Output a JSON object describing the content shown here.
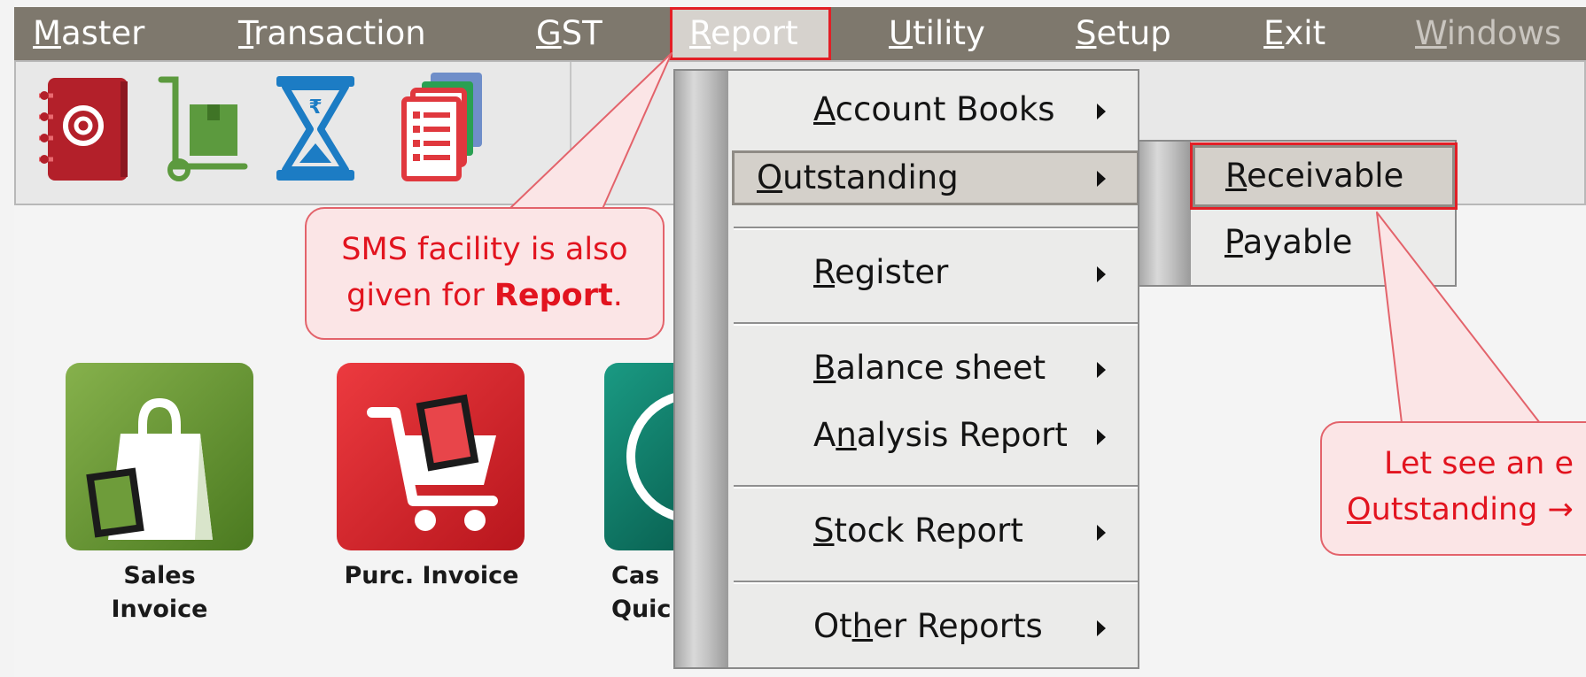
{
  "menubar": {
    "items": [
      {
        "pre": "",
        "ul": "M",
        "post": "aster"
      },
      {
        "pre": "",
        "ul": "T",
        "post": "ransaction"
      },
      {
        "pre": "",
        "ul": "G",
        "post": "ST"
      },
      {
        "pre": "",
        "ul": "R",
        "post": "eport"
      },
      {
        "pre": "",
        "ul": "U",
        "post": "tility"
      },
      {
        "pre": "",
        "ul": "S",
        "post": "etup"
      },
      {
        "pre": "",
        "ul": "E",
        "post": "xit"
      },
      {
        "pre": "",
        "ul": "W",
        "post": "indows"
      }
    ]
  },
  "toolbar": {
    "icons": [
      "address-book-icon",
      "hand-truck-icon",
      "hourglass-rupee-icon",
      "report-pages-icon"
    ]
  },
  "tiles": [
    {
      "label_line1": "Sales",
      "label_line2": "Invoice",
      "icon": "shopping-bag-icon",
      "color": "#5f8a2e"
    },
    {
      "label_line1": "Purc. Invoice",
      "label_line2": "",
      "icon": "shopping-cart-icon",
      "color": "#d81f26"
    },
    {
      "label_line1": "Cas",
      "label_line2": "Quic",
      "icon": "cash-icon",
      "color": "#0f7d6a"
    }
  ],
  "dropdown": {
    "items": [
      {
        "pre": "",
        "ul": "A",
        "post": "ccount Books"
      },
      {
        "pre": "",
        "ul": "O",
        "post": "utstanding"
      },
      {
        "pre": "",
        "ul": "R",
        "post": "egister"
      },
      {
        "pre": "",
        "ul": "B",
        "post": "alance sheet"
      },
      {
        "pre": "A",
        "ul": "n",
        "post": "alysis Report"
      },
      {
        "pre": "",
        "ul": "S",
        "post": "tock Report"
      },
      {
        "pre": "Ot",
        "ul": "h",
        "post": "er Reports"
      }
    ]
  },
  "submenu": {
    "items": [
      {
        "pre": "",
        "ul": "R",
        "post": "eceivable"
      },
      {
        "pre": "",
        "ul": "P",
        "post": "ayable"
      }
    ]
  },
  "callouts": {
    "sms": {
      "line1": "SMS facility is also",
      "line2_pre": "given for ",
      "line2_bold": "Report",
      "line2_post": "."
    },
    "example": {
      "line1": "Let see an e",
      "line2_ul": "O",
      "line2_rest": "utstanding →"
    }
  },
  "colors": {
    "menubar": "#7e786d",
    "highlight_outline": "#e21f26",
    "callout_text": "#e2141f",
    "callout_bg": "#fbe5e6"
  }
}
